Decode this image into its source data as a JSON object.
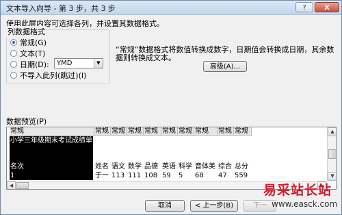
{
  "window": {
    "title": "文本导入向导 - 第 3 步，共 3 步",
    "help_label": "?",
    "close_label": "X"
  },
  "instruction": "使用此屏内容可选择各列，并设置其数据格式。",
  "column_format": {
    "legend": "列数据格式",
    "options": [
      {
        "label": "常规(G)",
        "selected": true
      },
      {
        "label": "文本(T)",
        "selected": false
      },
      {
        "label": "日期(D):",
        "selected": false
      },
      {
        "label": "不导入此列(跳过)(I)",
        "selected": false
      }
    ],
    "date_format": "YMD"
  },
  "description": "“常规”数据格式将数值转换成数字，日期值会转换成日期，其余数据则转换成文本。",
  "advanced_button": "高级(A)...",
  "preview": {
    "label": "数据预览(P)",
    "headers": [
      "常规",
      "常规",
      "常规",
      "常规",
      "常规",
      "常规",
      "常规",
      "常规",
      "常规",
      "常规"
    ],
    "rows": [
      [
        "小学三年级期末考试成绩单",
        "",
        "",
        "",
        "",
        "",
        "",
        "",
        "",
        ""
      ],
      [
        "",
        "",
        "",
        "",
        "",
        "",
        "",
        "",
        "",
        ""
      ],
      [
        "名次",
        "姓名",
        "语文",
        "数学",
        "品德",
        "英语",
        "科学",
        "音体美",
        "综合",
        "总分"
      ],
      [
        "1",
        "于一",
        "113",
        "111",
        "108",
        "59",
        "5",
        "68",
        "47",
        "559"
      ]
    ]
  },
  "buttons": {
    "cancel": "取消",
    "back": "< 上一步(B)",
    "next": "下一"
  },
  "watermark": {
    "text": "易采站长站",
    "url": "www.easck.com"
  }
}
